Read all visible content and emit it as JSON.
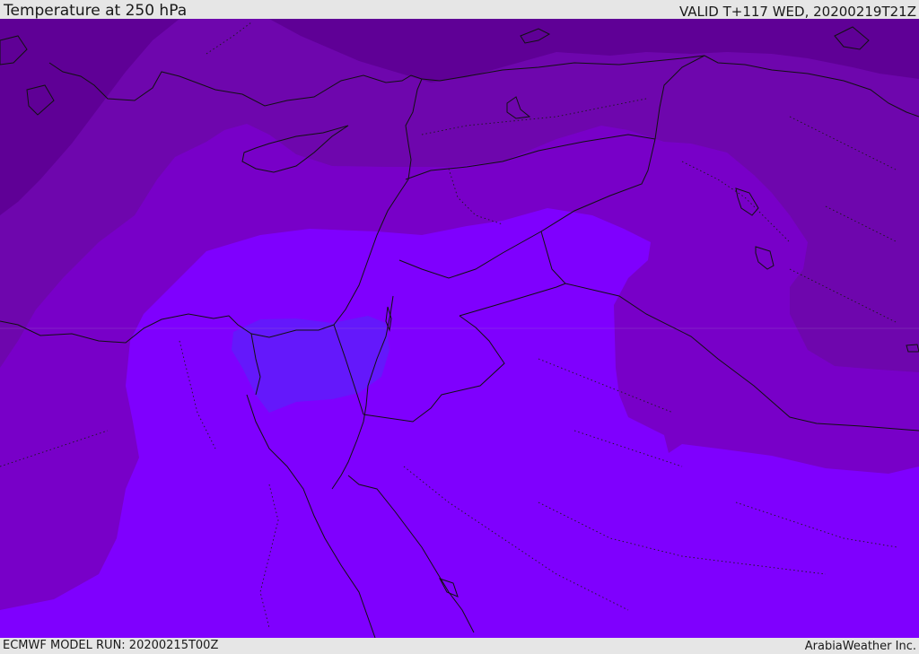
{
  "header": {
    "title": "Temperature at 250 hPa",
    "valid": "VALID T+117 WED, 20200219T21Z"
  },
  "footer": {
    "model_run": "ECMWF MODEL RUN: 20200215T00Z",
    "credit": "ArabiaWeather Inc."
  },
  "map": {
    "field": "Temperature at 250 hPa",
    "colors": {
      "coldest": "#5f0096",
      "very_cold": "#6e06ad",
      "cold": "#7800c8",
      "mild": "#7f00fe",
      "warm_core": "#6418fb",
      "borders": "#111111",
      "grid_line": "#9a6cc6"
    },
    "icons": [
      "coastline",
      "country-border",
      "province-border-dotted"
    ]
  }
}
